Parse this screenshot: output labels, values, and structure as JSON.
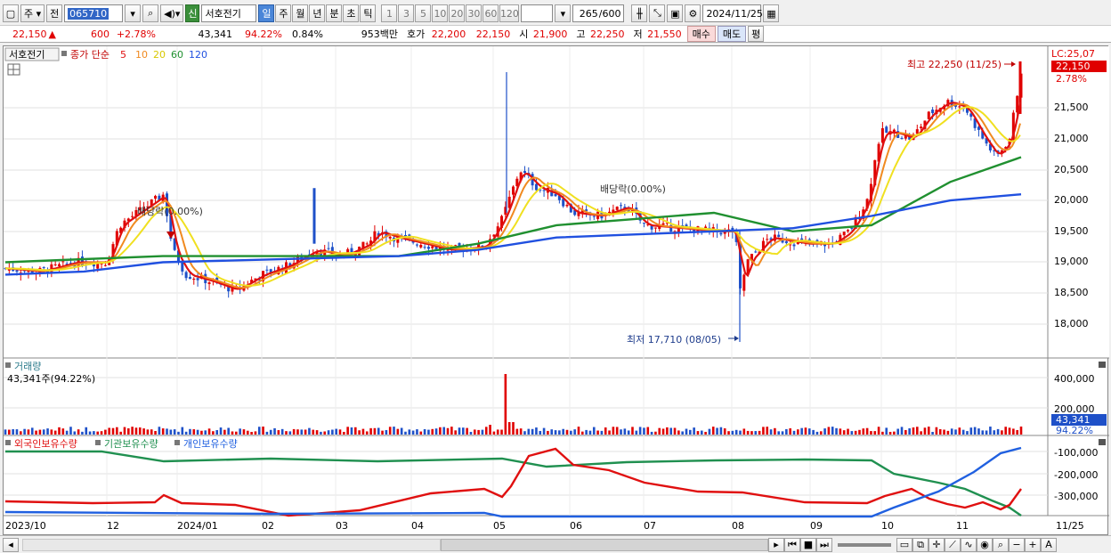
{
  "toolbar": {
    "market": "주",
    "prefix": "전",
    "code": "065710",
    "stock_badge": "신",
    "stock_name": "서호전기",
    "periods": [
      "일",
      "주",
      "월",
      "년",
      "분",
      "초",
      "틱"
    ],
    "active_period": "일",
    "minute_steps": [
      "1",
      "3",
      "5",
      "10",
      "20",
      "30",
      "60",
      "120"
    ],
    "count": "265",
    "count_max": "/600",
    "date": "2024/11/25"
  },
  "quote": {
    "price": "22,150",
    "change_arrow": "▲",
    "change": "600",
    "change_pct": "+2.78%",
    "volume": "43,341",
    "vol_ratio": "94.22%",
    "turnover": "0.84%",
    "amount": "953백만",
    "ask_label": "호가",
    "ask": "22,200",
    "bid": "22,150",
    "open_label": "시",
    "open": "21,900",
    "high_label": "고",
    "high": "22,250",
    "low_label": "저",
    "low": "21,550",
    "buy_label": "매수",
    "sell_label": "매도",
    "eval_label": "평"
  },
  "price_panel": {
    "stock_name": "서호전기",
    "legend_prefix": "종가 단순",
    "ma_periods": [
      "5",
      "10",
      "20",
      "60",
      "120"
    ],
    "lc_label": "LC:25,07",
    "current_price_tag": "22,150",
    "current_pct_tag": "2.78%",
    "high_note": "최고 22,250 (11/25)",
    "low_note": "최저 17,710 (08/05)",
    "dividend_notes": [
      "배당락(0.00%)",
      "배당락(0.00%)"
    ],
    "y_ticks": [
      "21,500",
      "21,000",
      "20,500",
      "20,000",
      "19,500",
      "19,000",
      "18,500",
      "18,000"
    ]
  },
  "volume_panel": {
    "title": "거래량",
    "subtitle": "43,341주(94.22%)",
    "y_ticks": [
      "400,000",
      "200,000"
    ],
    "current_tag": "43,341",
    "pct_tag": "94.22%"
  },
  "holdings_panel": {
    "series_labels": [
      "외국인보유수량",
      "기관보유수량",
      "개인보유수량"
    ],
    "y_ticks": [
      "-100,000",
      "-200,000",
      "-300,000"
    ]
  },
  "x_axis": {
    "labels": [
      "2023/10",
      "12",
      "2024/01",
      "02",
      "03",
      "04",
      "05",
      "06",
      "07",
      "08",
      "09",
      "10",
      "11",
      "11/25"
    ]
  },
  "colors": {
    "up": "#e00000",
    "down": "#1e50c8",
    "ma5": "#e01010",
    "ma10": "#f08a20",
    "ma20": "#f0e020",
    "ma60": "#209030",
    "ma120": "#2050e0",
    "foreign": "#e01010",
    "institution": "#209050",
    "individual": "#2060e0"
  },
  "chart_data": {
    "type": "line",
    "title": "서호전기",
    "price_series": [
      {
        "name": "MA5",
        "points": [
          [
            "2023/10",
            18900
          ],
          [
            "2023/11",
            18950
          ],
          [
            "2023/12",
            19100
          ],
          [
            "2023/12",
            19900
          ],
          [
            "2023/12",
            20150
          ],
          [
            "2024/01",
            19000
          ],
          [
            "2024/01",
            18600
          ],
          [
            "2024/02",
            18800
          ],
          [
            "2024/03",
            19200
          ],
          [
            "2024/04",
            19500
          ],
          [
            "2024/04",
            19300
          ],
          [
            "2024/05",
            19600
          ],
          [
            "2024/05",
            20300
          ],
          [
            "2024/06",
            20200
          ],
          [
            "2024/06",
            19800
          ],
          [
            "2024/07",
            19900
          ],
          [
            "2024/07",
            19600
          ],
          [
            "2024/08",
            19500
          ],
          [
            "2024/08",
            19200
          ],
          [
            "2024/09",
            19300
          ],
          [
            "2024/09",
            19200
          ],
          [
            "2024/10",
            21000
          ],
          [
            "2024/10",
            21300
          ],
          [
            "2024/11",
            21600
          ],
          [
            "2024/11",
            21000
          ],
          [
            "2024/11/25",
            21300
          ]
        ]
      },
      {
        "name": "MA60",
        "points": [
          [
            "2023/10",
            19000
          ],
          [
            "2023/12",
            19050
          ],
          [
            "2024/01",
            19100
          ],
          [
            "2024/04",
            19100
          ],
          [
            "2024/05",
            19300
          ],
          [
            "2024/06",
            19600
          ],
          [
            "2024/07",
            19700
          ],
          [
            "2024/08",
            19800
          ],
          [
            "2024/09",
            19500
          ],
          [
            "2024/10",
            19600
          ],
          [
            "2024/11",
            20300
          ],
          [
            "2024/11/25",
            20700
          ]
        ]
      },
      {
        "name": "MA120",
        "points": [
          [
            "2023/10",
            18800
          ],
          [
            "2023/12",
            18850
          ],
          [
            "2024/01",
            19000
          ],
          [
            "2024/04",
            19100
          ],
          [
            "2024/05",
            19200
          ],
          [
            "2024/06",
            19400
          ],
          [
            "2024/08",
            19500
          ],
          [
            "2024/09",
            19550
          ],
          [
            "2024/10",
            19750
          ],
          [
            "2024/11",
            20000
          ],
          [
            "2024/11/25",
            20100
          ]
        ]
      }
    ],
    "volume": {
      "spike": {
        "date": "2024/05",
        "value": 440000
      },
      "current": 43341
    },
    "y_range_price": [
      17700,
      22300
    ]
  }
}
